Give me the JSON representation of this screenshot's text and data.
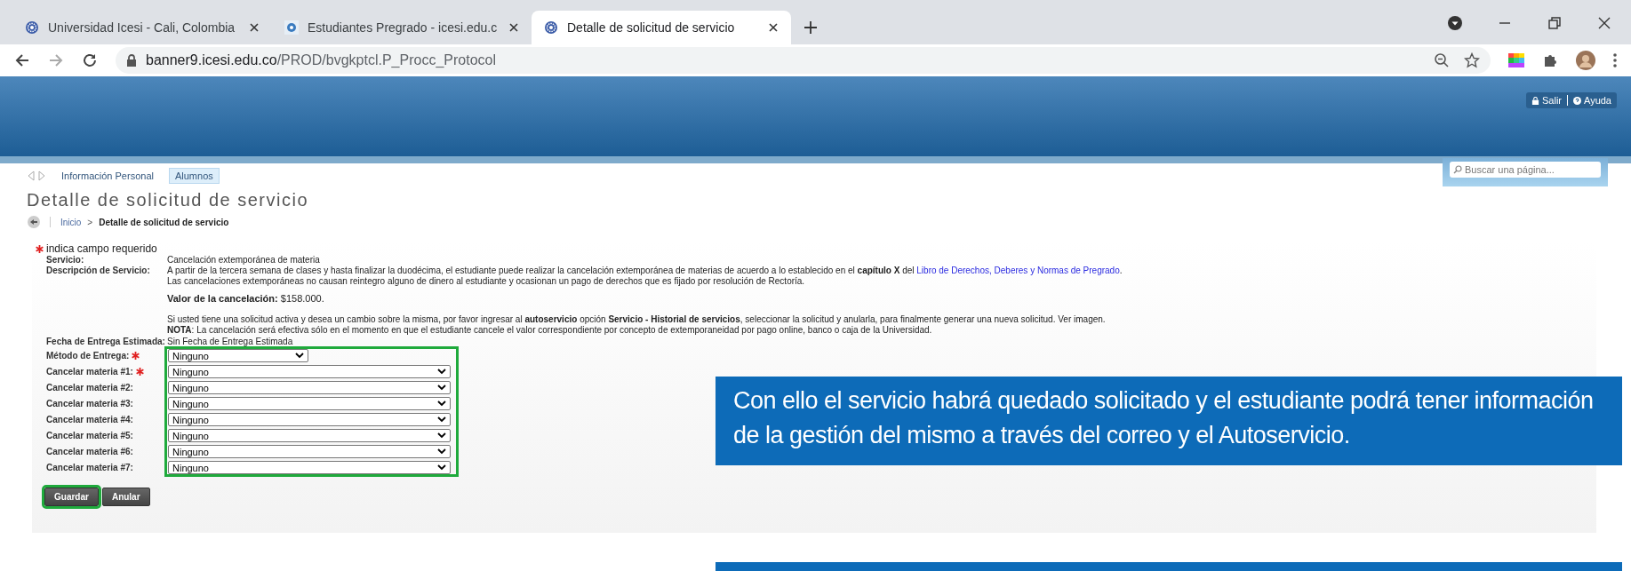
{
  "browser": {
    "tabs": [
      {
        "title": "Universidad Icesi - Cali, Colombia",
        "selected": false
      },
      {
        "title": "Estudiantes Pregrado - icesi.edu.c",
        "selected": false
      },
      {
        "title": "Detalle de solicitud de servicio",
        "selected": true
      }
    ],
    "url": {
      "host": "banner9.icesi.edu.co",
      "path": "/PROD/bvgkptcl.P_Procc_Protocol"
    }
  },
  "header": {
    "links": [
      "Salir",
      "Ayuda"
    ]
  },
  "nav": {
    "items": [
      {
        "label": "Información Personal",
        "selected": false
      },
      {
        "label": "Alumnos",
        "selected": true
      }
    ],
    "search_placeholder": "Buscar una página..."
  },
  "page_title": "Detalle de solicitud de servicio",
  "breadcrumb": [
    "Inicio",
    ">",
    "Detalle de solicitud de servicio"
  ],
  "form": {
    "required_note": "indica campo requerido",
    "service_label": "Servicio:",
    "service_value": "Cancelación extemporánea de materia",
    "description_label": "Descripción de Servicio:",
    "description": [
      {
        "kind": "text",
        "text": "A partir de la tercera semana de clases y hasta finalizar la duodécima, el estudiante puede realizar la cancelación extemporánea de materias de acuerdo a lo establecido en el **capítulo X** del ",
        "link": "Libro de Derechos, Deberes y Normas de Pregrado",
        "after": "."
      },
      {
        "kind": "text",
        "text": "Las cancelaciones extemporáneas no causan reintegro alguno de dinero al estudiante y ocasionan un pago de derechos que es fijado por resolución de Rectoría."
      },
      {
        "kind": "price",
        "text": "**Valor de la cancelación:** $158.000."
      },
      {
        "kind": "text",
        "text": "Si usted tiene una solicitud activa y desea un cambio sobre la misma, por favor ingresar al **autoservicio** opción **Servicio - Historial de servicios**, seleccionar la solicitud y anularla, para finalmente generar una nueva solicitud. Ver imagen."
      },
      {
        "kind": "text",
        "text": "**NOTA**: La cancelación será efectiva sólo en el momento en que el estudiante cancele el valor correspondiente por concepto de extemporaneidad por pago online, banco o caja de la Universidad."
      }
    ],
    "date_label": "Fecha de Entrega Estimada:",
    "date_value": "Sin Fecha de Entrega Estimada",
    "selects": [
      {
        "label": "Método de Entrega:",
        "value": "Ninguno",
        "required": true,
        "kind": "short"
      },
      {
        "label": "Cancelar materia #1:",
        "value": "Ninguno",
        "required": true,
        "kind": "long"
      },
      {
        "label": "Cancelar materia #2:",
        "value": "Ninguno",
        "required": false,
        "kind": "long"
      },
      {
        "label": "Cancelar materia #3:",
        "value": "Ninguno",
        "required": false,
        "kind": "long"
      },
      {
        "label": "Cancelar materia #4:",
        "value": "Ninguno",
        "required": false,
        "kind": "long"
      },
      {
        "label": "Cancelar materia #5:",
        "value": "Ninguno",
        "required": false,
        "kind": "long"
      },
      {
        "label": "Cancelar materia #6:",
        "value": "Ninguno",
        "required": false,
        "kind": "long"
      },
      {
        "label": "Cancelar materia #7:",
        "value": "Ninguno",
        "required": false,
        "kind": "long"
      }
    ],
    "buttons": [
      {
        "label": "Guardar",
        "highlighted": true
      },
      {
        "label": "Anular",
        "highlighted": false
      }
    ]
  },
  "callout": {
    "text": "Con ello el servicio habrá quedado solicitado y el estudiante podrá  tener información de la gestión del mismo a través del correo y el Autoservicio."
  }
}
